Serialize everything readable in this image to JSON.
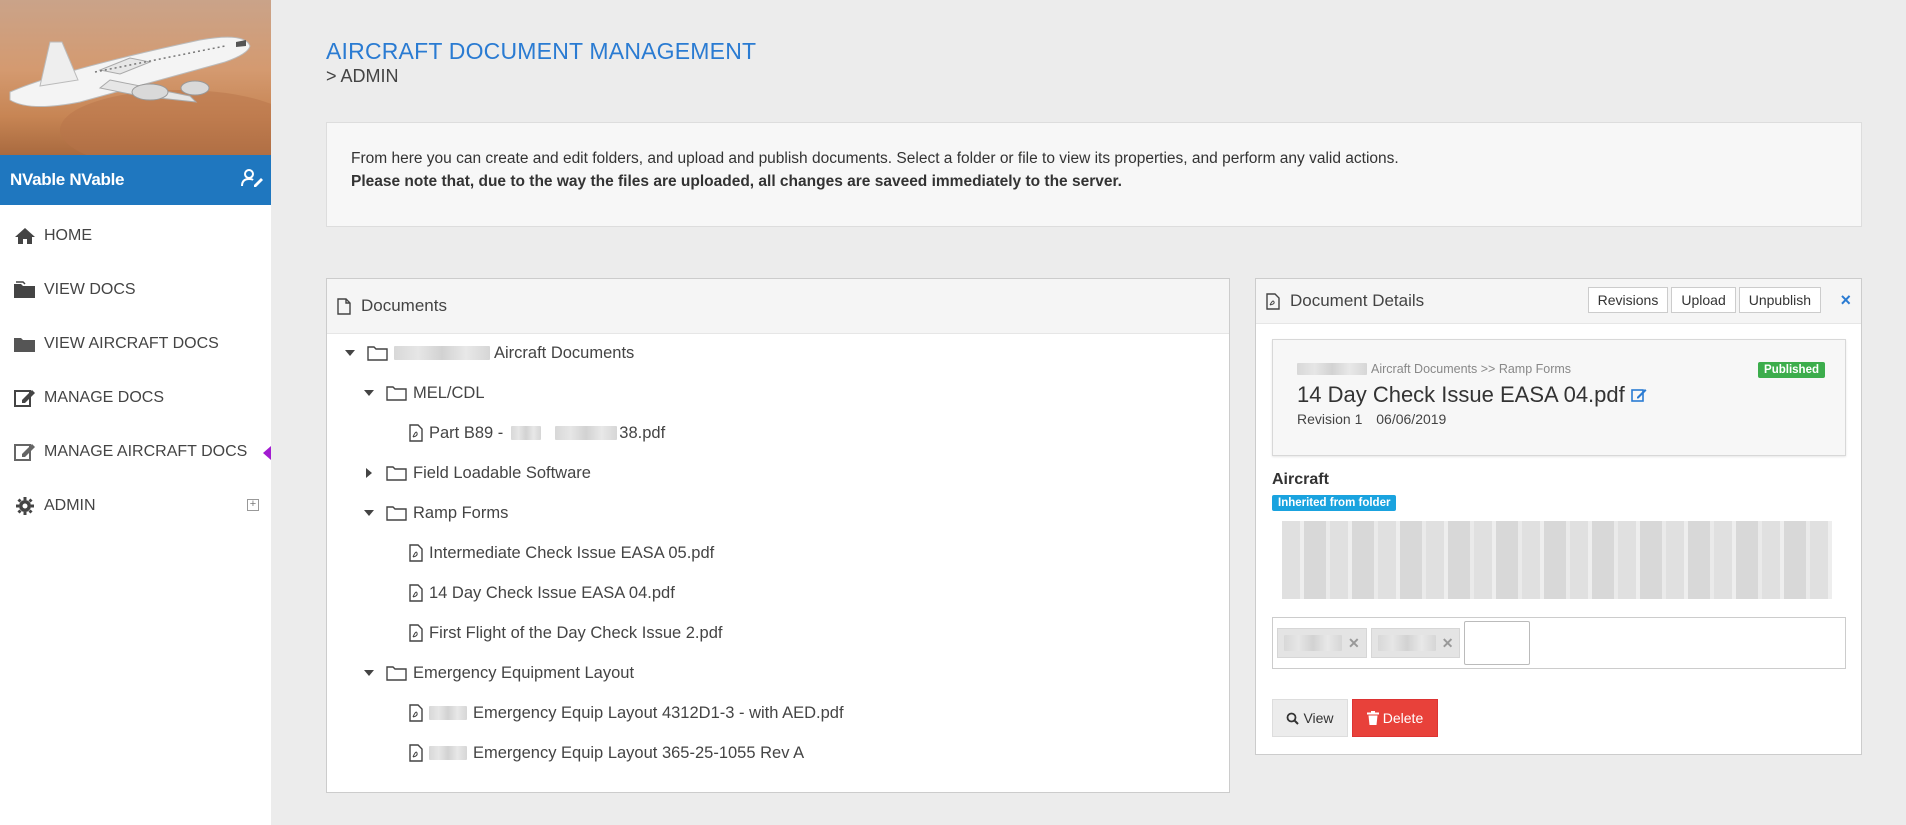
{
  "sidebar": {
    "user_name": "NVable NVable",
    "items": [
      {
        "label": "HOME",
        "icon": "home-icon"
      },
      {
        "label": "VIEW DOCS",
        "icon": "folder-icon"
      },
      {
        "label": "VIEW AIRCRAFT DOCS",
        "icon": "folder-icon"
      },
      {
        "label": "MANAGE DOCS",
        "icon": "edit-icon"
      },
      {
        "label": "MANAGE AIRCRAFT DOCS",
        "icon": "edit-icon"
      },
      {
        "label": "ADMIN",
        "icon": "gear-icon"
      }
    ]
  },
  "header": {
    "title": "AIRCRAFT DOCUMENT MANAGEMENT",
    "subtitle": "> ADMIN"
  },
  "info": {
    "line1": "From here you can create and edit folders, and upload and publish documents. Select a folder or file to view its properties, and perform any valid actions.",
    "line2": "Please note that, due to the way the files are uploaded, all changes are saveed immediately to the server."
  },
  "documents": {
    "title": "Documents",
    "tree": [
      {
        "label": "Aircraft Documents",
        "type": "folder",
        "expanded": true
      },
      {
        "label": "MEL/CDL",
        "type": "folder",
        "expanded": true
      },
      {
        "label": "Part B89 -",
        "suffix": "38.pdf",
        "type": "file"
      },
      {
        "label": "Field Loadable Software",
        "type": "folder",
        "expanded": false
      },
      {
        "label": "Ramp Forms",
        "type": "folder",
        "expanded": true
      },
      {
        "label": "Intermediate Check Issue EASA 05.pdf",
        "type": "file"
      },
      {
        "label": "14 Day Check Issue EASA 04.pdf",
        "type": "file"
      },
      {
        "label": "First Flight of the Day Check Issue 2.pdf",
        "type": "file"
      },
      {
        "label": "Emergency Equipment Layout",
        "type": "folder",
        "expanded": true
      },
      {
        "label": "Emergency Equip Layout 4312D1-3 - with AED.pdf",
        "type": "file"
      },
      {
        "label": "Emergency Equip Layout 365-25-1055 Rev A",
        "type": "file"
      }
    ]
  },
  "details": {
    "title": "Document Details",
    "buttons": {
      "revisions": "Revisions",
      "upload": "Upload",
      "unpublish": "Unpublish"
    },
    "close": "×",
    "path": "Aircraft Documents >> Ramp Forms",
    "status": "Published",
    "file_name": "14 Day Check Issue EASA 04.pdf",
    "revision": "Revision 1",
    "date": "06/06/2019",
    "aircraft_label": "Aircraft",
    "inherited": "Inherited from folder",
    "view_label": "View",
    "delete_label": "Delete"
  },
  "colors": {
    "accent": "#2a7bd2",
    "userbar": "#1f77bf",
    "published": "#3cad4c",
    "inherited": "#1aa3df",
    "delete": "#e8413a"
  }
}
